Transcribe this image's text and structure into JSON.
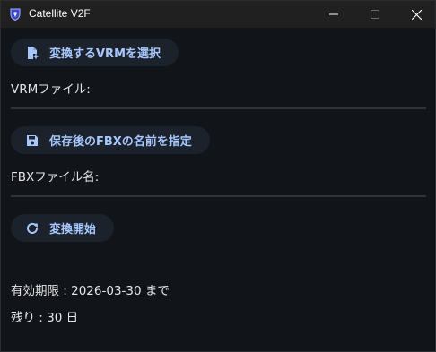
{
  "window": {
    "title": "Catellite V2F",
    "controls": {
      "minimize_icon": "minimize-icon",
      "maximize_icon": "maximize-icon",
      "close_icon": "close-icon"
    }
  },
  "actions": {
    "select_vrm": {
      "label": "変換するVRMを選択",
      "icon": "file-plus-icon"
    },
    "save_fbx": {
      "label": "保存後のFBXの名前を指定",
      "icon": "floppy-disk-icon"
    },
    "start": {
      "label": "変換開始",
      "icon": "refresh-icon"
    }
  },
  "fields": {
    "vrm_file_label": "VRMファイル:",
    "fbx_file_label": "FBXファイル名:"
  },
  "license": {
    "expiry": "有効期限 : 2026-03-30 まで",
    "remaining": "残り : 30 日"
  },
  "colors": {
    "background": "#111418",
    "titlebar": "#202020",
    "button_bg": "#1c222b",
    "accent": "#a6c8ff",
    "text": "#e6e6e6",
    "divider": "#2f343b"
  }
}
